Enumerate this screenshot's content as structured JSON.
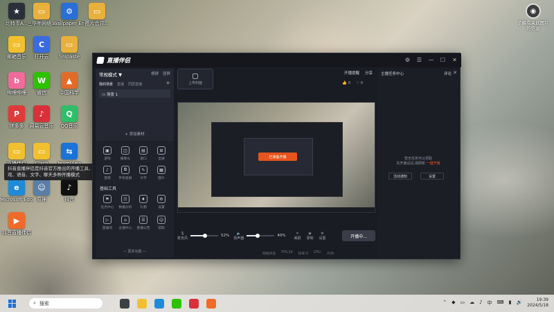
{
  "desktop": {
    "icons": [
      {
        "label": "比特币A...",
        "color": "#2b2f3a",
        "glyph": "★"
      },
      {
        "label": "三华年网络...",
        "color": "#e8b03c",
        "glyph": "▭"
      },
      {
        "label": "Wallpaper Engine",
        "color": "#2a6fd6",
        "glyph": "⚙"
      },
      {
        "label": "图片合并...",
        "color": "#e8b03c",
        "glyph": "▭"
      },
      {
        "label": "邮箱音乐",
        "color": "#f0c030",
        "glyph": "▭"
      },
      {
        "label": "打开云",
        "color": "#3b6be0",
        "glyph": "C"
      },
      {
        "label": "Snipaste",
        "color": "#e8b03c",
        "glyph": "▭"
      },
      {
        "label": "哔哩哔哩",
        "color": "#f06b9a",
        "glyph": "b"
      },
      {
        "label": "微信",
        "color": "#2dc100",
        "glyph": "W"
      },
      {
        "label": "中国科学",
        "color": "#e26b2a",
        "glyph": "▲"
      },
      {
        "label": "拼多多",
        "color": "#e03a3a",
        "glyph": "P"
      },
      {
        "label": "网易云音乐",
        "color": "#d9303a",
        "glyph": "♪"
      },
      {
        "label": "QQ音乐",
        "color": "#2fbf6a",
        "glyph": "Q"
      },
      {
        "label": "直播伴侣",
        "color": "#f0c030",
        "glyph": "▭"
      },
      {
        "label": "Clash",
        "color": "#f0c030",
        "glyph": "▭"
      },
      {
        "label": "TeamView",
        "color": "#1b72d8",
        "glyph": "⇆"
      },
      {
        "label": "Microsoft Edge",
        "color": "#1f8ad8",
        "glyph": "e"
      },
      {
        "label": "原神",
        "color": "#5a7ea8",
        "glyph": "☺"
      },
      {
        "label": "抖音",
        "color": "#111111",
        "glyph": "♪"
      },
      {
        "label": "抖音直播伴侣",
        "color": "#f06a2a",
        "glyph": "▶"
      }
    ],
    "helper_label": "了解有关此图片的信息",
    "tooltip": "抖音直播伴侣是抖音官方推出的开播工具，支持游戏、语音、文字、聊天多种开播模式"
  },
  "app": {
    "title": "直播伴侣",
    "window_controls": [
      "⚙",
      "☰",
      "—",
      "☐",
      "✕"
    ],
    "left_panel": {
      "mode": "常规模式 ▼",
      "mode_links": [
        "横屏",
        "竖屏"
      ],
      "scene_tabs": [
        "我的场景",
        "直播",
        "同屏直播"
      ],
      "scene_item": "▭ 场景 1",
      "add_source": "+ 添加素材",
      "tools_row1": [
        {
          "icon": "▣",
          "label": "游戏"
        },
        {
          "icon": "◫",
          "label": "摄像头"
        },
        {
          "icon": "▤",
          "label": "窗口"
        },
        {
          "icon": "⊞",
          "label": "全屏"
        }
      ],
      "tools_row2": [
        {
          "icon": "♪",
          "label": "音频"
        },
        {
          "icon": "⧉",
          "label": "手机投屏"
        },
        {
          "icon": "✎",
          "label": "文字"
        },
        {
          "icon": "▦",
          "label": "图片"
        }
      ],
      "section_title": "基础工具",
      "tools_row3": [
        {
          "icon": "⚑",
          "label": "任务中心"
        },
        {
          "icon": "☷",
          "label": "数据分析"
        },
        {
          "icon": "♦",
          "label": "礼物"
        },
        {
          "icon": "⚙",
          "label": "设置"
        }
      ],
      "tools_row4": [
        {
          "icon": "▷",
          "label": "直播间"
        },
        {
          "icon": "⌂",
          "label": "主播中心"
        },
        {
          "icon": "☰",
          "label": "直播公告"
        },
        {
          "icon": "☺",
          "label": "帮助"
        }
      ],
      "more_tools": "— 更多功能 —"
    },
    "center": {
      "upload_cover": "上传封面",
      "top_links": [
        "开播提醒",
        "分享"
      ],
      "likes": [
        "👍 0",
        "♡ 0"
      ],
      "preview_button": "已准备开播",
      "mic_label": "麦克风",
      "mic_value": 52,
      "mic_pct": "52%",
      "speaker_label": "扬声器",
      "speaker_value": 40,
      "speaker_pct": "40%",
      "ctrl_icons": [
        {
          "icon": "✕",
          "label": "美颜"
        },
        {
          "icon": "◉",
          "label": "录制"
        },
        {
          "icon": "⚙",
          "label": "设置"
        }
      ],
      "live_button": "开播中...",
      "status": [
        "网络状态",
        "FPS:30",
        "码率:0",
        "CPU:",
        "内存:"
      ]
    },
    "right_panel": {
      "title": "主播任务中心",
      "action": "评论",
      "close": "✕",
      "message_line1": "暂无任务可以领取",
      "message_line2": "先开播试试,或刷新",
      "message_link": "一键开播",
      "buttons": [
        "活动通知",
        "设置"
      ]
    }
  },
  "taskbar": {
    "search_placeholder": "搜索",
    "apps": [
      "#3c4043",
      "#f0c030",
      "#1f8ad8",
      "#2dc100",
      "#d9303a",
      "#f06a2a"
    ],
    "tray_icons": [
      "⌃",
      "◆",
      "▭",
      "☁",
      "♪",
      "中",
      "⌨",
      "▮",
      "🔊"
    ],
    "time": "19:39",
    "date": "2024/5/18"
  }
}
